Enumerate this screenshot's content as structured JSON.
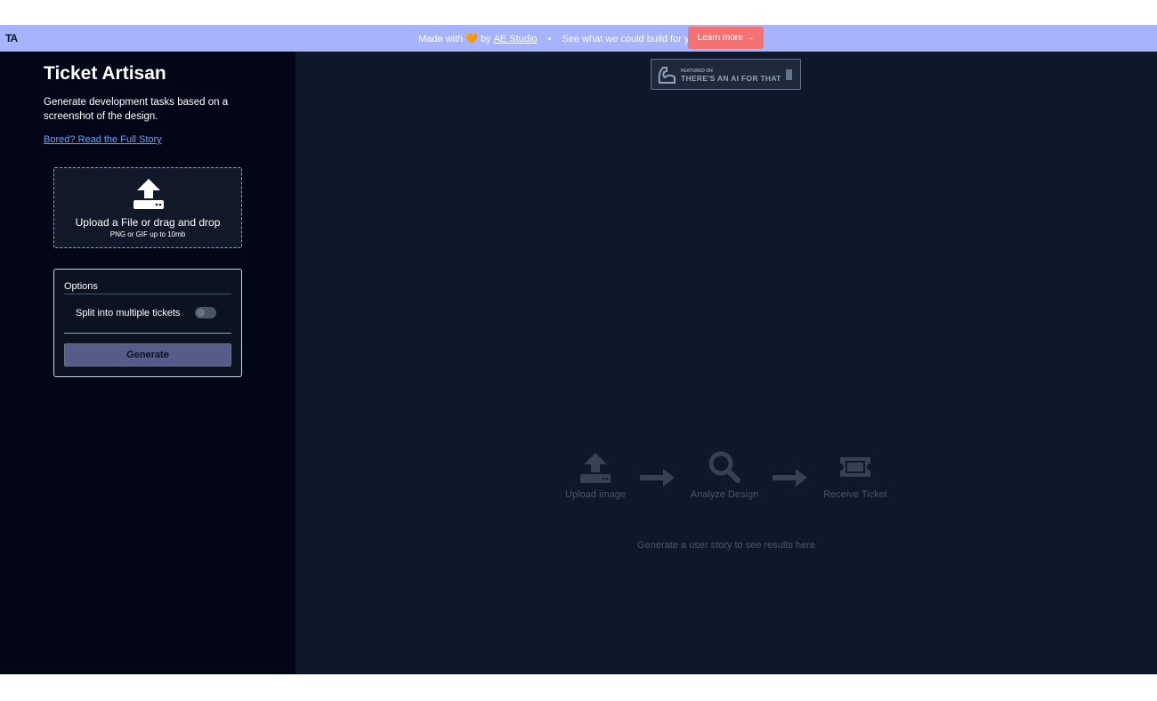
{
  "banner": {
    "logo": "TA",
    "made_with": "Made with 🧡 by",
    "studio_link": "AE Studio",
    "dot": "•",
    "tagline": "See what we could build for you",
    "learn_more": "Learn more →"
  },
  "sidebar": {
    "title": "Ticket Artisan",
    "description": "Generate development tasks based on a screenshot of the design.",
    "story_link": "Bored? Read the Full Story",
    "upload": {
      "title": "Upload a File or drag and drop",
      "hint": "PNG or GIF up to 10mb"
    },
    "options": {
      "label": "Options",
      "split_label": "Split into multiple tickets",
      "split_enabled": false,
      "generate_button": "Generate"
    }
  },
  "main": {
    "badge": {
      "small": "FEATURED ON",
      "big": "THERE'S AN AI FOR THAT"
    },
    "steps": [
      {
        "label": "Upload image",
        "icon": "upload-icon"
      },
      {
        "label": "Analyze Design",
        "icon": "search-icon"
      },
      {
        "label": "Receive Ticket",
        "icon": "ticket-icon"
      }
    ],
    "empty_hint": "Generate a user story to see results here"
  },
  "colors": {
    "banner_bg": "#a5b4fc",
    "learn_button": "#f87171",
    "sidebar_bg": "#020617",
    "main_bg": "#0f172a",
    "link": "#60a5fa",
    "generate_button": "#565c8a"
  }
}
